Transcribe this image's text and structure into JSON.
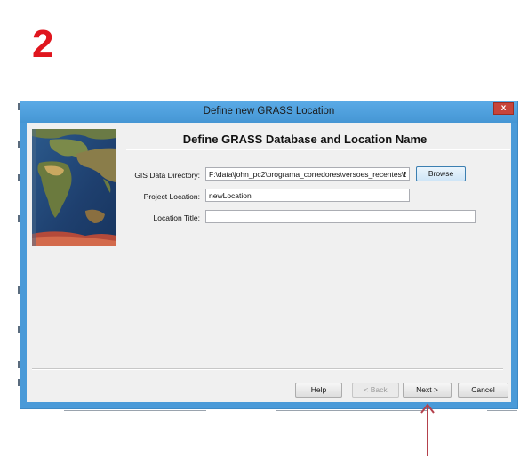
{
  "annotation": {
    "step_number": "2",
    "arrow_color": "#b4414c"
  },
  "dialog": {
    "title": "Define new GRASS Location",
    "close_glyph": "x",
    "heading": "Define GRASS Database and Location Name",
    "fields": {
      "gis_data_directory": {
        "label": "GIS Data Directory:",
        "value": "F:\\data\\john_pc2\\programa_corredores\\versoes_recentes\\B"
      },
      "project_location": {
        "label": "Project Location:",
        "value": "newLocation"
      },
      "location_title": {
        "label": "Location Title:",
        "value": ""
      }
    },
    "browse_label": "Browse",
    "buttons": {
      "help": "Help",
      "back": "< Back",
      "next": "Next >",
      "cancel": "Cancel"
    },
    "accent_color": "#4a9ad8"
  }
}
